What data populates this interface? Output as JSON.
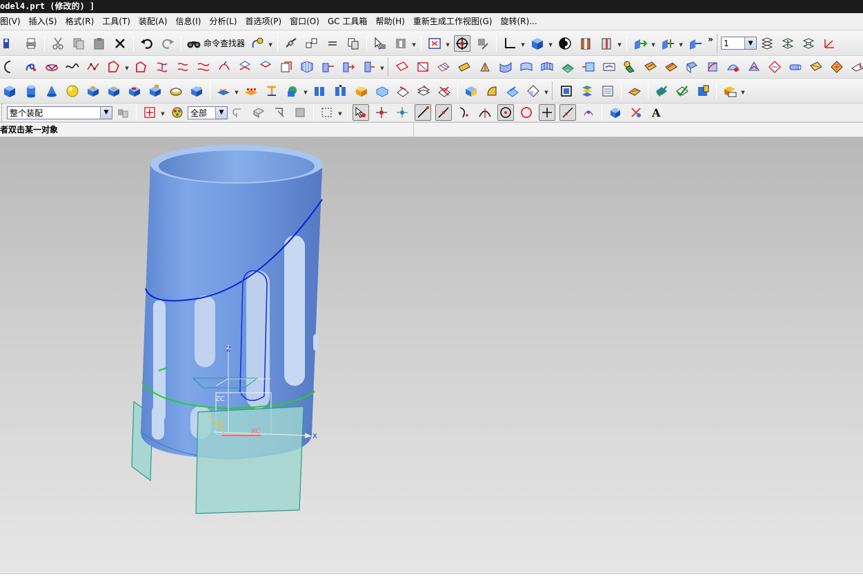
{
  "window": {
    "title": "odel4.prt  (修改的)  ]"
  },
  "menubar": {
    "items": [
      {
        "label": "图(V)"
      },
      {
        "label": "插入(S)"
      },
      {
        "label": "格式(R)"
      },
      {
        "label": "工具(T)"
      },
      {
        "label": "装配(A)"
      },
      {
        "label": "信息(I)"
      },
      {
        "label": "分析(L)"
      },
      {
        "label": "首选项(P)"
      },
      {
        "label": "窗口(O)"
      },
      {
        "label": "GC 工具箱"
      },
      {
        "label": "帮助(H)"
      },
      {
        "label": "重新生成工作视图(G)"
      },
      {
        "label": "旋转(R)..."
      }
    ]
  },
  "toolbar_standard": {
    "command_finder_label": "命令查找器",
    "overflow_label": "»",
    "layer_value": "1"
  },
  "selection_bar": {
    "scope_value": "整个装配",
    "filter_value": "全部"
  },
  "cue_line": {
    "text": "者双击某一对象"
  },
  "viewport": {
    "triad_labels": {
      "z": "Z",
      "zc": "ZC",
      "yc": "YC",
      "xc": "XC",
      "x": "X"
    },
    "colors": {
      "body": "#6f9ae0",
      "body_light": "#a9c6f2",
      "curve_blue": "#0a23d6",
      "curve_green": "#1fd41f",
      "plane_fill": "#9fd6d0",
      "plane_edge": "#2a9c8c"
    }
  }
}
